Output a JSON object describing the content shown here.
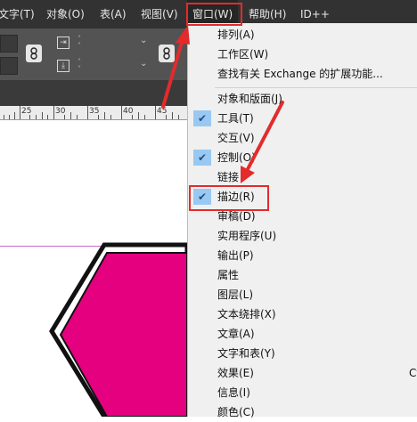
{
  "menubar": {
    "items": [
      "文字(T)",
      "对象(O)",
      "表(A)",
      "视图(V)",
      "窗口(W)",
      "帮助(H)",
      "ID++"
    ]
  },
  "ruler": {
    "labels": [
      "25",
      "30",
      "35",
      "40",
      "45"
    ]
  },
  "window_menu": {
    "group1": [
      "排列(A)",
      "工作区(W)",
      "查找有关 Exchange 的扩展功能..."
    ],
    "group2": [
      {
        "label": "对象和版面(J)",
        "checked": false
      },
      {
        "label": "工具(T)",
        "checked": true
      },
      {
        "label": "交互(V)",
        "checked": false
      },
      {
        "label": "控制(O)",
        "checked": true
      },
      {
        "label": "链接",
        "checked": false
      },
      {
        "label": "描边(R)",
        "checked": true
      },
      {
        "label": "审稿(D)",
        "checked": false
      },
      {
        "label": "实用程序(U)",
        "checked": false
      },
      {
        "label": "输出(P)",
        "checked": false
      },
      {
        "label": "属性",
        "checked": false
      },
      {
        "label": "图层(L)",
        "checked": false
      },
      {
        "label": "文本绕排(X)",
        "checked": false
      },
      {
        "label": "文章(A)",
        "checked": false
      },
      {
        "label": "文字和表(Y)",
        "checked": false
      },
      {
        "label": "效果(E)",
        "checked": false
      },
      {
        "label": "信息(I)",
        "checked": false
      },
      {
        "label": "颜色(C)",
        "checked": false
      }
    ],
    "shortcut_fragment": "Ct"
  },
  "colors": {
    "menubar_bg": "#323232",
    "toolbar_bg": "#535353",
    "dropdown_bg": "#f0f0f0",
    "check_bg": "#99c9f2",
    "highlight_red": "#e32b2b",
    "shape_fill": "#e4007f",
    "shape_stroke": "#111111"
  }
}
